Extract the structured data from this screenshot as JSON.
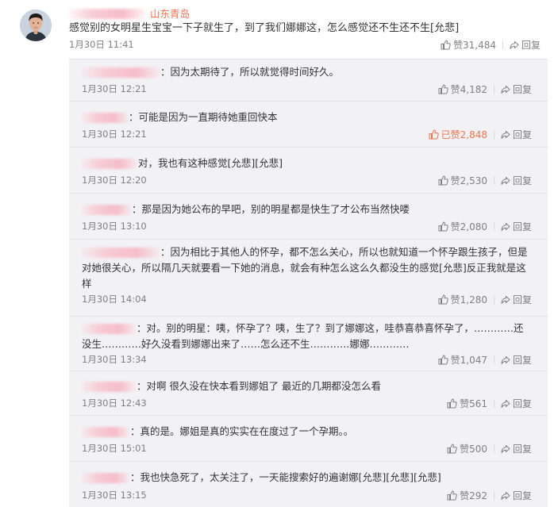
{
  "main_comment": {
    "location": "山东青岛",
    "text": "感觉别的女明星生宝宝一下子就生了，到了我们娜娜这，怎么感觉还不生还不生[允悲]",
    "time": "1月30日 11:41",
    "like_label": "赞31,484",
    "reply_label": "回复"
  },
  "replies": [
    {
      "text": "：因为太期待了，所以就觉得时间好久。",
      "time": "1月30日 12:21",
      "like_label": "赞4,182",
      "reply_label": "回复",
      "liked": false
    },
    {
      "text": "：可能是因为一直期待她重回快本",
      "time": "1月30日 12:21",
      "like_label": "已赞2,848",
      "reply_label": "回复",
      "liked": true
    },
    {
      "text": "对，我也有这种感觉[允悲][允悲]",
      "time": "1月30日 12:20",
      "like_label": "赞2,530",
      "reply_label": "回复",
      "liked": false
    },
    {
      "text": "：那是因为她公布的早吧，别的明星都是快生了才公布当然快喽",
      "time": "1月30日 13:10",
      "like_label": "赞2,080",
      "reply_label": "回复",
      "liked": false
    },
    {
      "text": "：因为相比于其他人的怀孕，都不怎么关心，所以也就知道一个怀孕跟生孩子，但是对她很关心，所以隔几天就要看一下她的消息，就会有种怎么这么久都没生的感觉[允悲]反正我就是这样",
      "time": "1月30日 14:04",
      "like_label": "赞1,280",
      "reply_label": "回复",
      "liked": false
    },
    {
      "text": "：对。别的明星：咦，怀孕了？咦，生了？到了娜娜这，哇恭喜恭喜怀孕了，…………还没生…………好久没看到娜娜出来了……怎么还不生…………娜娜…………",
      "time": "1月30日 13:34",
      "like_label": "赞1,047",
      "reply_label": "回复",
      "liked": false
    },
    {
      "text": "：对啊 很久没在快本看到娜姐了 最近的几期都没怎么看",
      "time": "1月30日 12:43",
      "like_label": "赞561",
      "reply_label": "回复",
      "liked": false
    },
    {
      "text": "：真的是。娜姐是真的实实在在度过了一个孕期。。",
      "time": "1月30日 15:01",
      "like_label": "赞500",
      "reply_label": "回复",
      "liked": false
    },
    {
      "text": "：我也快急死了，太关注了，一天能搜索好的遍谢娜[允悲][允悲][允悲]",
      "time": "1月30日 13:15",
      "like_label": "赞292",
      "reply_label": "回复",
      "liked": false
    }
  ],
  "colors": {
    "accent": "#eb7350",
    "muted": "#808080",
    "reply_background": "#f2f2f5"
  },
  "icons": [
    "avatar",
    "share-icon",
    "like-icon",
    "liked-icon"
  ]
}
